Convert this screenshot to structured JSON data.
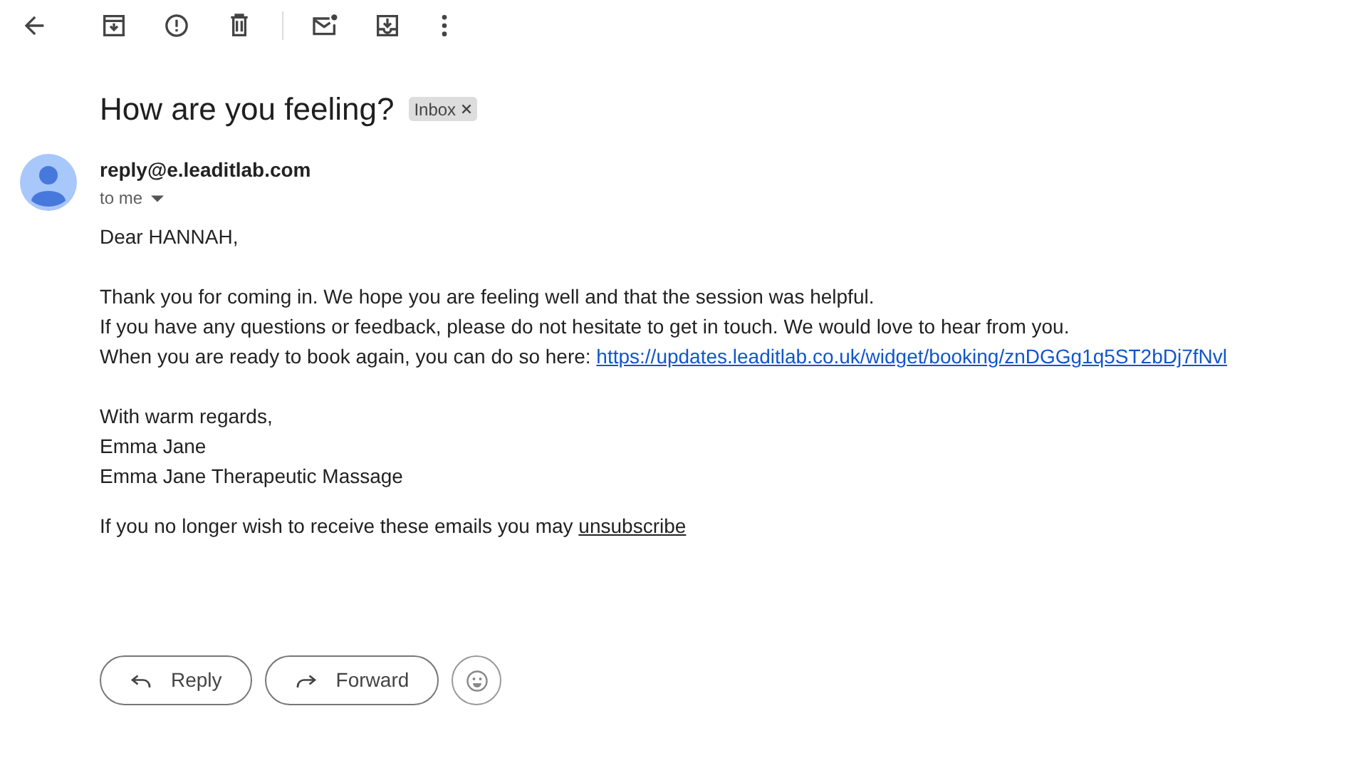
{
  "subject": "How are you feeling?",
  "labels": [
    {
      "text": "Inbox",
      "removable": true
    }
  ],
  "sender": {
    "email": "reply@e.leaditlab.com",
    "recipient": "to me"
  },
  "paragraphs": [
    {
      "lines": [
        {
          "text": "Dear HANNAH,"
        }
      ]
    },
    {
      "lines": [
        {
          "text": "Thank you for coming in. We hope you are feeling well and that the session was helpful."
        },
        {
          "text": "If you have any questions or feedback, please do not hesitate to get in touch. We would love to hear from you."
        },
        {
          "text": "When you are ready to book again, you can do so here: ",
          "link": "https://updates.leaditlab.co.uk/widget/booking/znDGGg1q5ST2bDj7fNvl"
        }
      ]
    },
    {
      "lines": [
        {
          "text": "With warm regards,"
        },
        {
          "text": "Emma Jane"
        },
        {
          "text": "Emma Jane Therapeutic Massage"
        }
      ]
    }
  ],
  "footer": {
    "text": "If you no longer wish to receive these emails you may ",
    "link": "unsubscribe"
  },
  "actions": [
    {
      "kind": "reply",
      "label": "Reply"
    },
    {
      "kind": "forward",
      "label": "Forward"
    },
    {
      "kind": "emoji"
    }
  ]
}
